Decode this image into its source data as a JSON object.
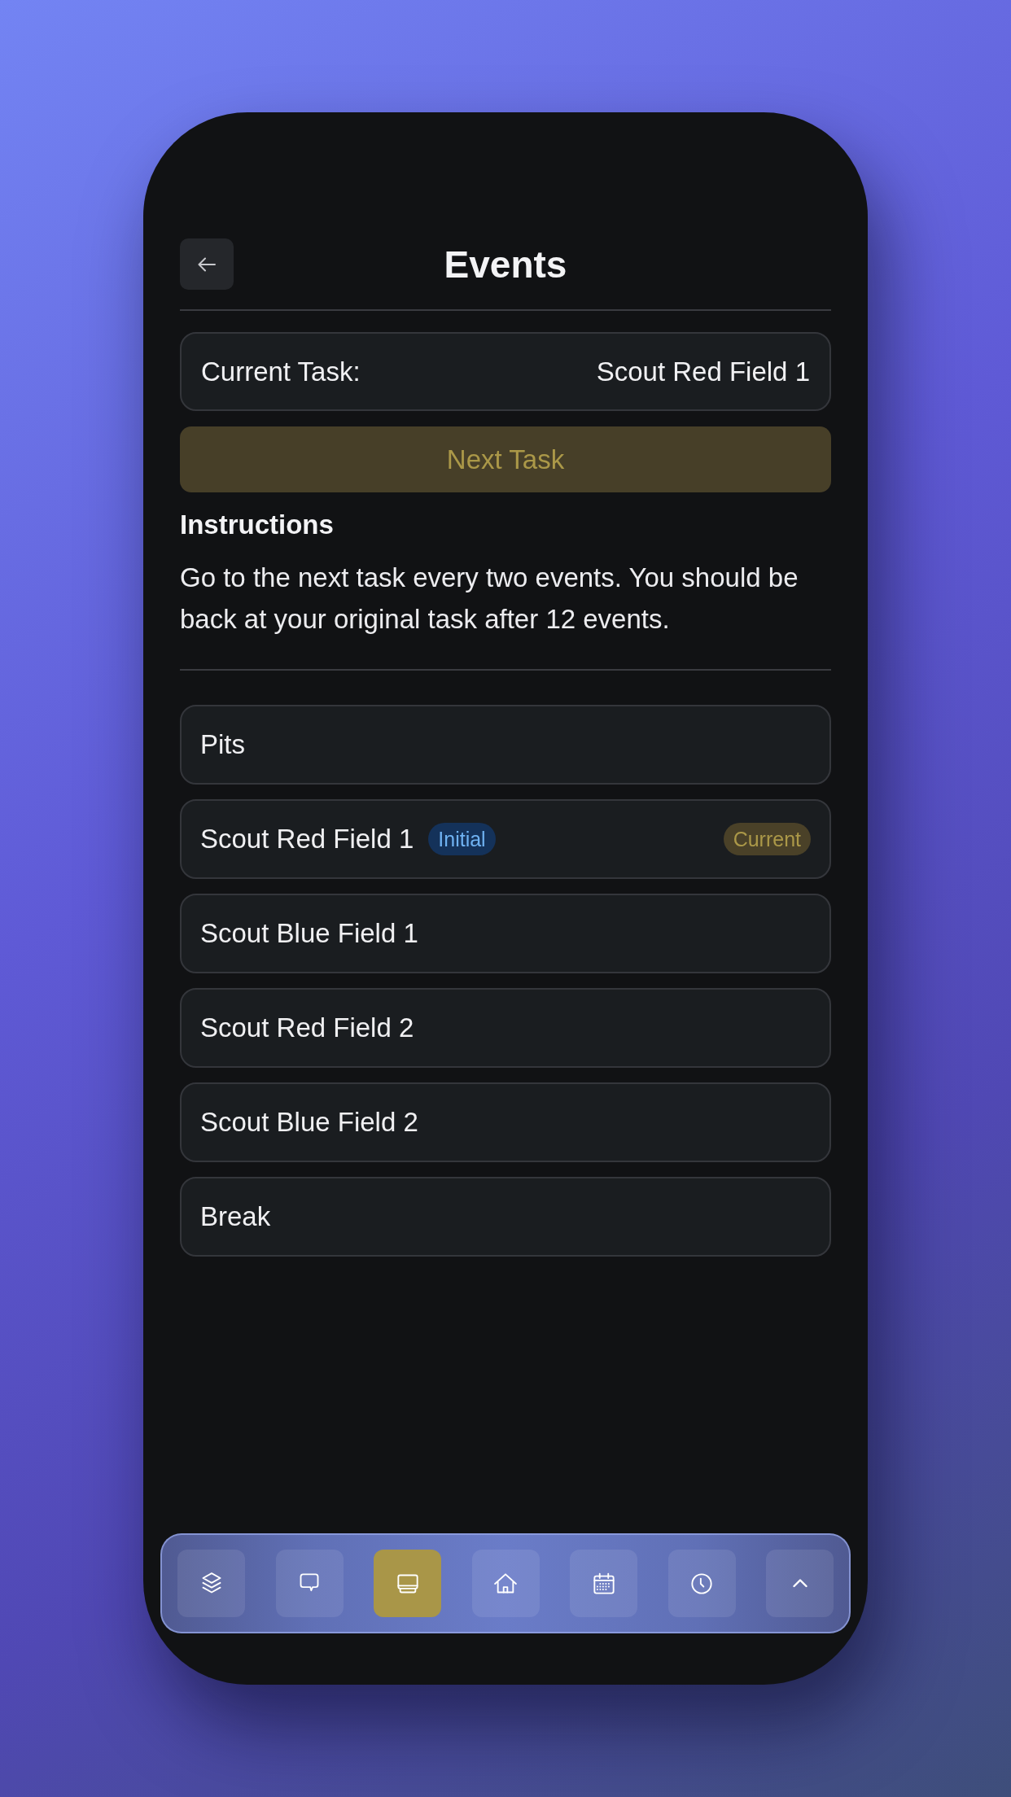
{
  "header": {
    "title": "Events"
  },
  "current_task": {
    "label": "Current Task:",
    "value": "Scout Red Field 1"
  },
  "next_button": {
    "label": "Next Task"
  },
  "instructions": {
    "heading": "Instructions",
    "text": "Go to the next task every two events. You should be back at your original task after 12 events."
  },
  "tasks": [
    {
      "name": "Pits"
    },
    {
      "name": "Scout Red Field 1",
      "badges": [
        {
          "kind": "initial",
          "label": "Initial"
        },
        {
          "kind": "current",
          "label": "Current"
        }
      ]
    },
    {
      "name": "Scout Blue Field 1"
    },
    {
      "name": "Scout Red Field 2"
    },
    {
      "name": "Scout Blue Field 2"
    },
    {
      "name": "Break"
    }
  ],
  "nav": {
    "items": [
      {
        "selected": false
      },
      {
        "selected": false
      },
      {
        "selected": true
      },
      {
        "selected": false
      },
      {
        "selected": false
      },
      {
        "selected": false
      },
      {
        "selected": false
      }
    ]
  }
}
